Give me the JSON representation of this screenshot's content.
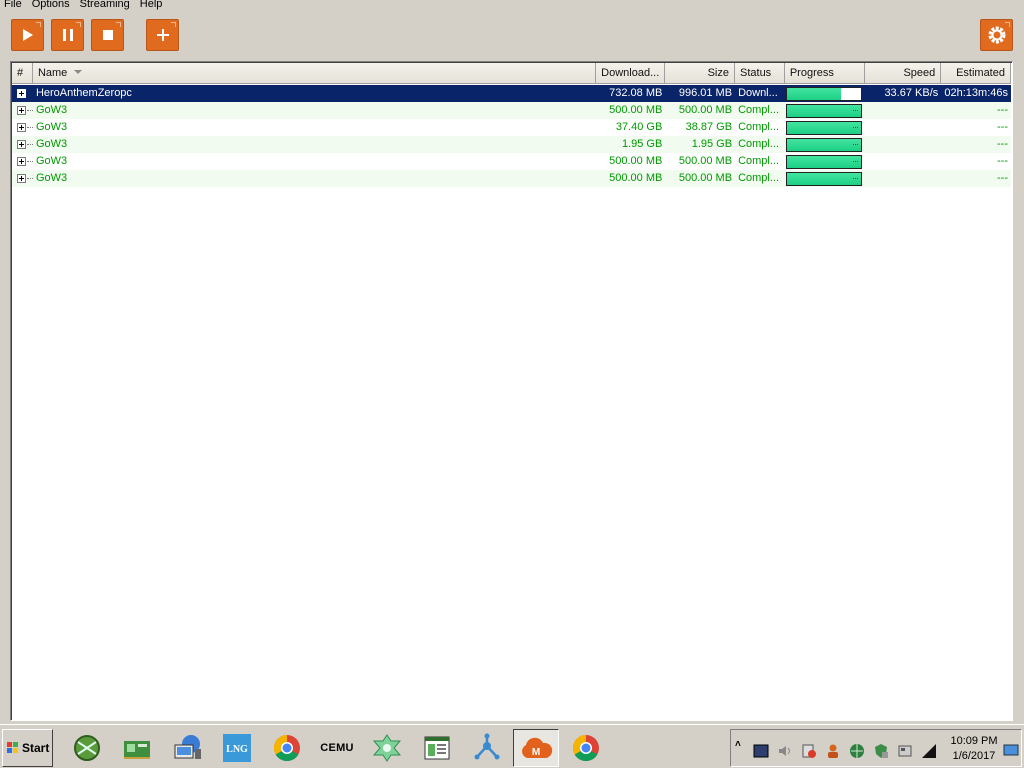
{
  "menu": [
    "File",
    "Options",
    "Streaming",
    "Help"
  ],
  "toolbar": {
    "play_icon": "play-icon",
    "pause_icon": "pause-icon",
    "stop_icon": "stop-icon",
    "add_icon": "add-icon",
    "settings_icon": "gear-icon",
    "accent": "#e06b1f"
  },
  "columns": {
    "num": "#",
    "name": "Name",
    "downloaded": "Download...",
    "size": "Size",
    "status": "Status",
    "progress": "Progress",
    "speed": "Speed",
    "estimated": "Estimated"
  },
  "rows": [
    {
      "name": "HeroAnthemZeropc",
      "downloaded": "732.08 MB",
      "size": "996.01 MB",
      "status": "Downl...",
      "progress": 0.735,
      "speed": "33.67 KB/s",
      "estimated": "02h:13m:46s"
    },
    {
      "name": "GoW3",
      "downloaded": "500.00 MB",
      "size": "500.00 MB",
      "status": "Compl...",
      "progress": 1.0,
      "speed": "",
      "estimated": "---"
    },
    {
      "name": "GoW3",
      "downloaded": "37.40 GB",
      "size": "38.87 GB",
      "status": "Compl...",
      "progress": 1.0,
      "speed": "",
      "estimated": "---"
    },
    {
      "name": "GoW3",
      "downloaded": "1.95 GB",
      "size": "1.95 GB",
      "status": "Compl...",
      "progress": 1.0,
      "speed": "",
      "estimated": "---"
    },
    {
      "name": "GoW3",
      "downloaded": "500.00 MB",
      "size": "500.00 MB",
      "status": "Compl...",
      "progress": 1.0,
      "speed": "",
      "estimated": "---"
    },
    {
      "name": "GoW3",
      "downloaded": "500.00 MB",
      "size": "500.00 MB",
      "status": "Compl...",
      "progress": 1.0,
      "speed": "",
      "estimated": "---"
    }
  ],
  "taskbar": {
    "start_label": "Start",
    "apps": [
      "network-globe-icon",
      "gpu-card-icon",
      "computer-network-icon",
      "lng-icon",
      "chrome-icon",
      "cemu-label-icon",
      "ppsspp-icon",
      "document-app-icon",
      "network-share-icon",
      "mega-cloud-icon",
      "chrome-icon"
    ],
    "cemu_label": "CEMU",
    "lng_label": "LNG",
    "mega_label": "M",
    "clock_time": "10:09 PM",
    "clock_date": "1/6/2017"
  }
}
